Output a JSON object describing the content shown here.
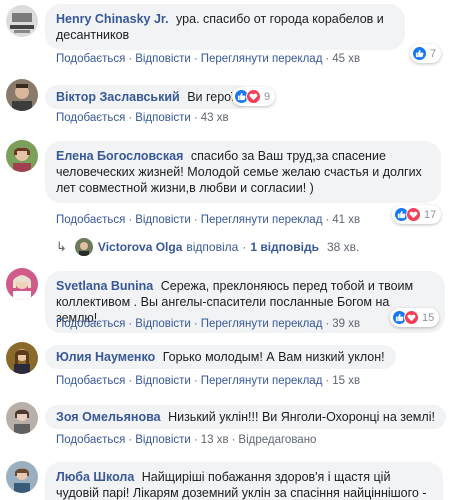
{
  "comments": [
    {
      "author": "Henry Chinasky Jr.",
      "text": "ура. спасибо от города корабелов и десантников",
      "actions": {
        "like": "Подобається",
        "reply": "Відповісти",
        "translate": "Переглянути переклад",
        "time": "45 хв"
      },
      "reactions": {
        "types": [
          "like"
        ],
        "count": "7"
      }
    },
    {
      "author": "Віктор Заславський",
      "text": "Ви герої!",
      "actions": {
        "like": "Подобається",
        "reply": "Відповісти",
        "time": "43 хв"
      },
      "reactions": {
        "types": [
          "like",
          "love"
        ],
        "count": "9"
      }
    },
    {
      "author": "Елена Богословская",
      "text": "спасибо за Ваш труд,за спасение человеческих жизней! Молодой семье желаю счастья и долгих лет совместной жизни,в любви и согласии! )",
      "actions": {
        "like": "Подобається",
        "reply": "Відповісти",
        "translate": "Переглянути переклад",
        "time": "41 хв"
      },
      "reactions": {
        "types": [
          "like",
          "love"
        ],
        "count": "17"
      },
      "replies": {
        "author": "Victorova Olga",
        "verb": "відповіла",
        "count_label": "1 відповідь",
        "time": "38 хв."
      }
    },
    {
      "author": "Svetlana Bunina",
      "text": "Сережа, преклоняюсь перед тобой и твоим коллективом . Вы ангелы-спасители посланные Богом на землю!",
      "actions": {
        "like": "Подобається",
        "reply": "Відповісти",
        "translate": "Переглянути переклад",
        "time": "39 хв"
      },
      "reactions": {
        "types": [
          "like",
          "love"
        ],
        "count": "15"
      }
    },
    {
      "author": "Юлия Науменко",
      "text": "Горько молодым! А Вам низкий уклон!",
      "actions": {
        "like": "Подобається",
        "reply": "Відповісти",
        "translate": "Переглянути переклад",
        "time": "15 хв"
      }
    },
    {
      "author": "Зоя Омельянова",
      "text": "Низький уклін!!! Ви Янголи-Охоронці на землі!",
      "actions": {
        "like": "Подобається",
        "reply": "Відповісти",
        "time": "13 хв",
        "edited": "Відредаговано"
      }
    },
    {
      "author": "Люба Школа",
      "text": "Найщиріші побажання здоров'я і щастя цій чудовій парі! Лікарям доземний уклін за спасіння найціннішого - життя!"
    }
  ],
  "colors": {
    "link": "#385898",
    "bubble": "#f2f3f5",
    "like": "#1877f2",
    "love": "#f33e58"
  }
}
